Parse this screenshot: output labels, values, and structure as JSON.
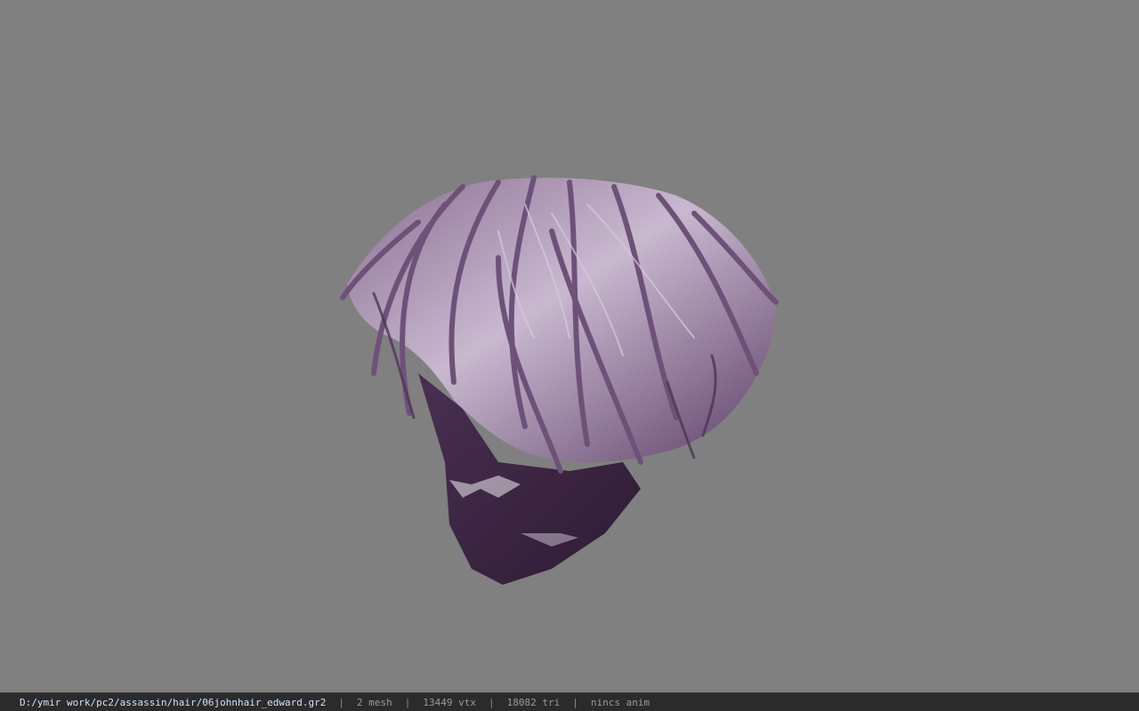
{
  "viewer": {
    "background_color": "#808080",
    "hair_color": "#6e5178",
    "model_description": "3d-hair-model"
  },
  "statusbar": {
    "file_path": "D:/ymir work/pc2/assassin/hair/06johnhair_edward.gr2",
    "separator": "|",
    "mesh_count": "2 mesh",
    "vertex_count": "13449 vtx",
    "triangle_count": "18082 tri",
    "animation": "nincs anim"
  }
}
